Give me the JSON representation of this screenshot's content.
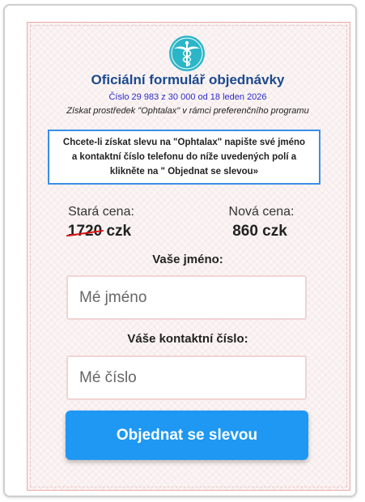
{
  "header": {
    "logo_icon": "caduceus-icon",
    "title": "Oficiální formulář objednávky",
    "subtitle": "Číslo 29 983 z 30 000 od 18 leden 2026",
    "program": "Získat prostředek \"Ophtalax\" v rámci preferenčního programu"
  },
  "notice": {
    "text": "Chcete-li získat slevu na \"Ophtalax\" napište své jméno a kontaktní číslo telefonu do níže uvedených polí a klikněte na \" Objednat se slevou»"
  },
  "prices": {
    "old_label": "Stará cena:",
    "old_value": "1720",
    "old_currency": "czk",
    "new_label": "Nová cena:",
    "new_value": "860 czk"
  },
  "form": {
    "name_label": "Vaše jméno:",
    "name_placeholder": "Mé jméno",
    "name_value": "",
    "phone_label": "Váše kontaktní číslo:",
    "phone_placeholder": "Mé číslo",
    "phone_value": "",
    "submit_label": "Objednat se slevou"
  },
  "colors": {
    "title": "#1b4a8f",
    "subtitle": "#2c2cc9",
    "notice_border": "#3a8ee6",
    "button": "#1e98f3",
    "strike": "#dd1111",
    "logo": "#2bb6c8"
  }
}
